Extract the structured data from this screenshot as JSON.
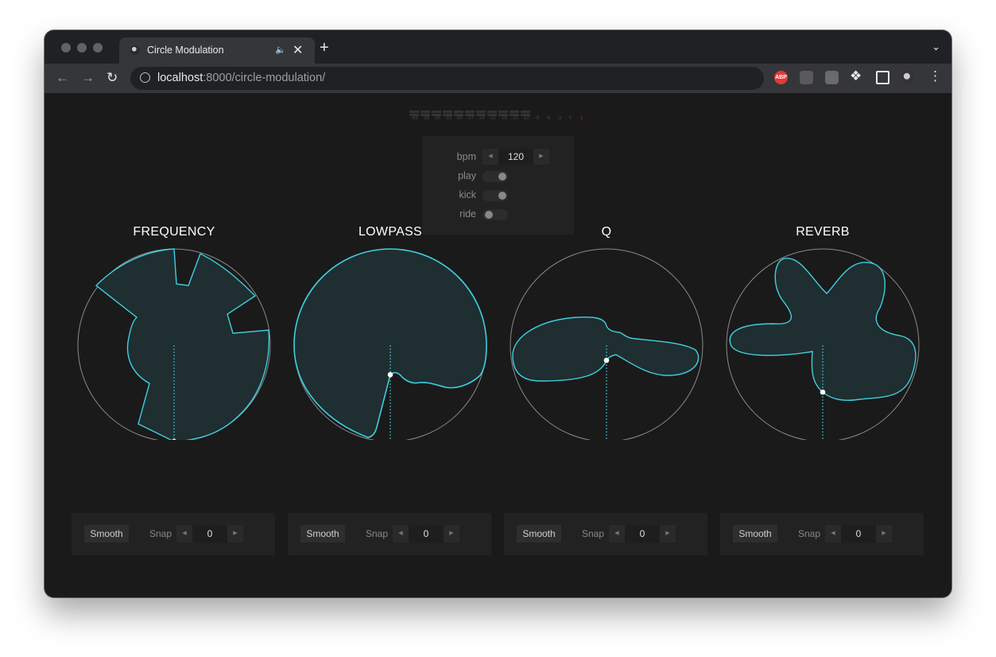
{
  "browser": {
    "tab_title": "Circle Modulation",
    "url_host": "localhost",
    "url_path": ":8000/circle-modulation/",
    "abp_label": "ABP"
  },
  "meter": {
    "labels": [
      "-66",
      "-39",
      "-36",
      "-33",
      "-30",
      "-27",
      "-24",
      "-21",
      "-18",
      "-15",
      "-12",
      "-9",
      "-6",
      "-3",
      "0",
      "3"
    ]
  },
  "transport": {
    "bpm_label": "bpm",
    "bpm_value": "120",
    "play_label": "play",
    "play_on": true,
    "kick_label": "kick",
    "kick_on": true,
    "ride_label": "ride",
    "ride_on": false
  },
  "modules": [
    {
      "title": "FREQUENCY",
      "smooth_label": "Smooth",
      "snap_label": "Snap",
      "snap_value": "0"
    },
    {
      "title": "LOWPASS",
      "smooth_label": "Smooth",
      "snap_label": "Snap",
      "snap_value": "0"
    },
    {
      "title": "Q",
      "smooth_label": "Smooth",
      "snap_label": "Snap",
      "snap_value": "0"
    },
    {
      "title": "REVERB",
      "smooth_label": "Smooth",
      "snap_label": "Snap",
      "snap_value": "0"
    }
  ],
  "colors": {
    "accent": "#3fcfe0",
    "fill": "#1f2e31",
    "circle_outline": "#8a8a8a"
  }
}
